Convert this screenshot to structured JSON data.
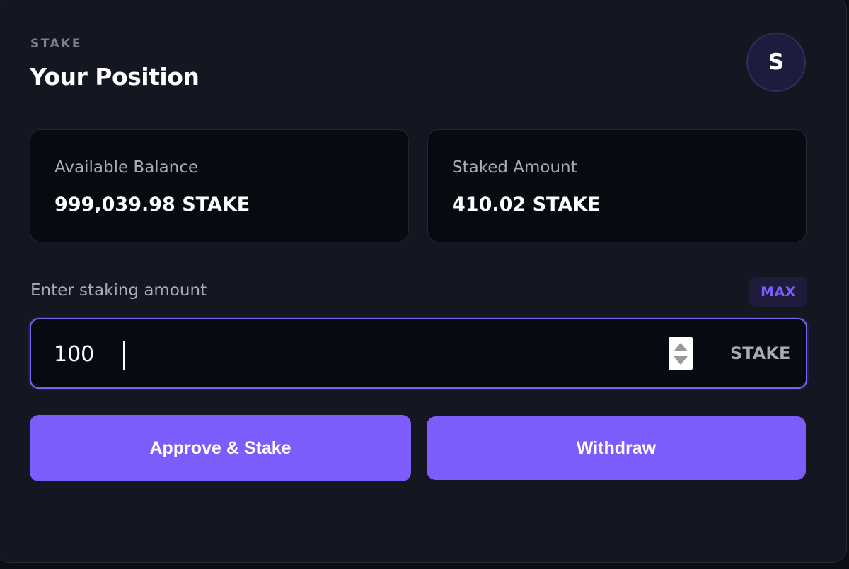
{
  "header": {
    "eyebrow": "STAKE",
    "title": "Your Position",
    "avatar_letter": "S"
  },
  "stats": {
    "available": {
      "label": "Available Balance",
      "value": "999,039.98 STAKE"
    },
    "staked": {
      "label": "Staked Amount",
      "value": "410.02 STAKE"
    }
  },
  "form": {
    "label": "Enter staking amount",
    "max_label": "MAX",
    "amount_value": "100",
    "unit": "STAKE"
  },
  "actions": {
    "stake_label": "Approve & Stake",
    "withdraw_label": "Withdraw"
  },
  "colors": {
    "accent": "#7c5cfa",
    "background": "#141621",
    "panel": "#070a10"
  }
}
